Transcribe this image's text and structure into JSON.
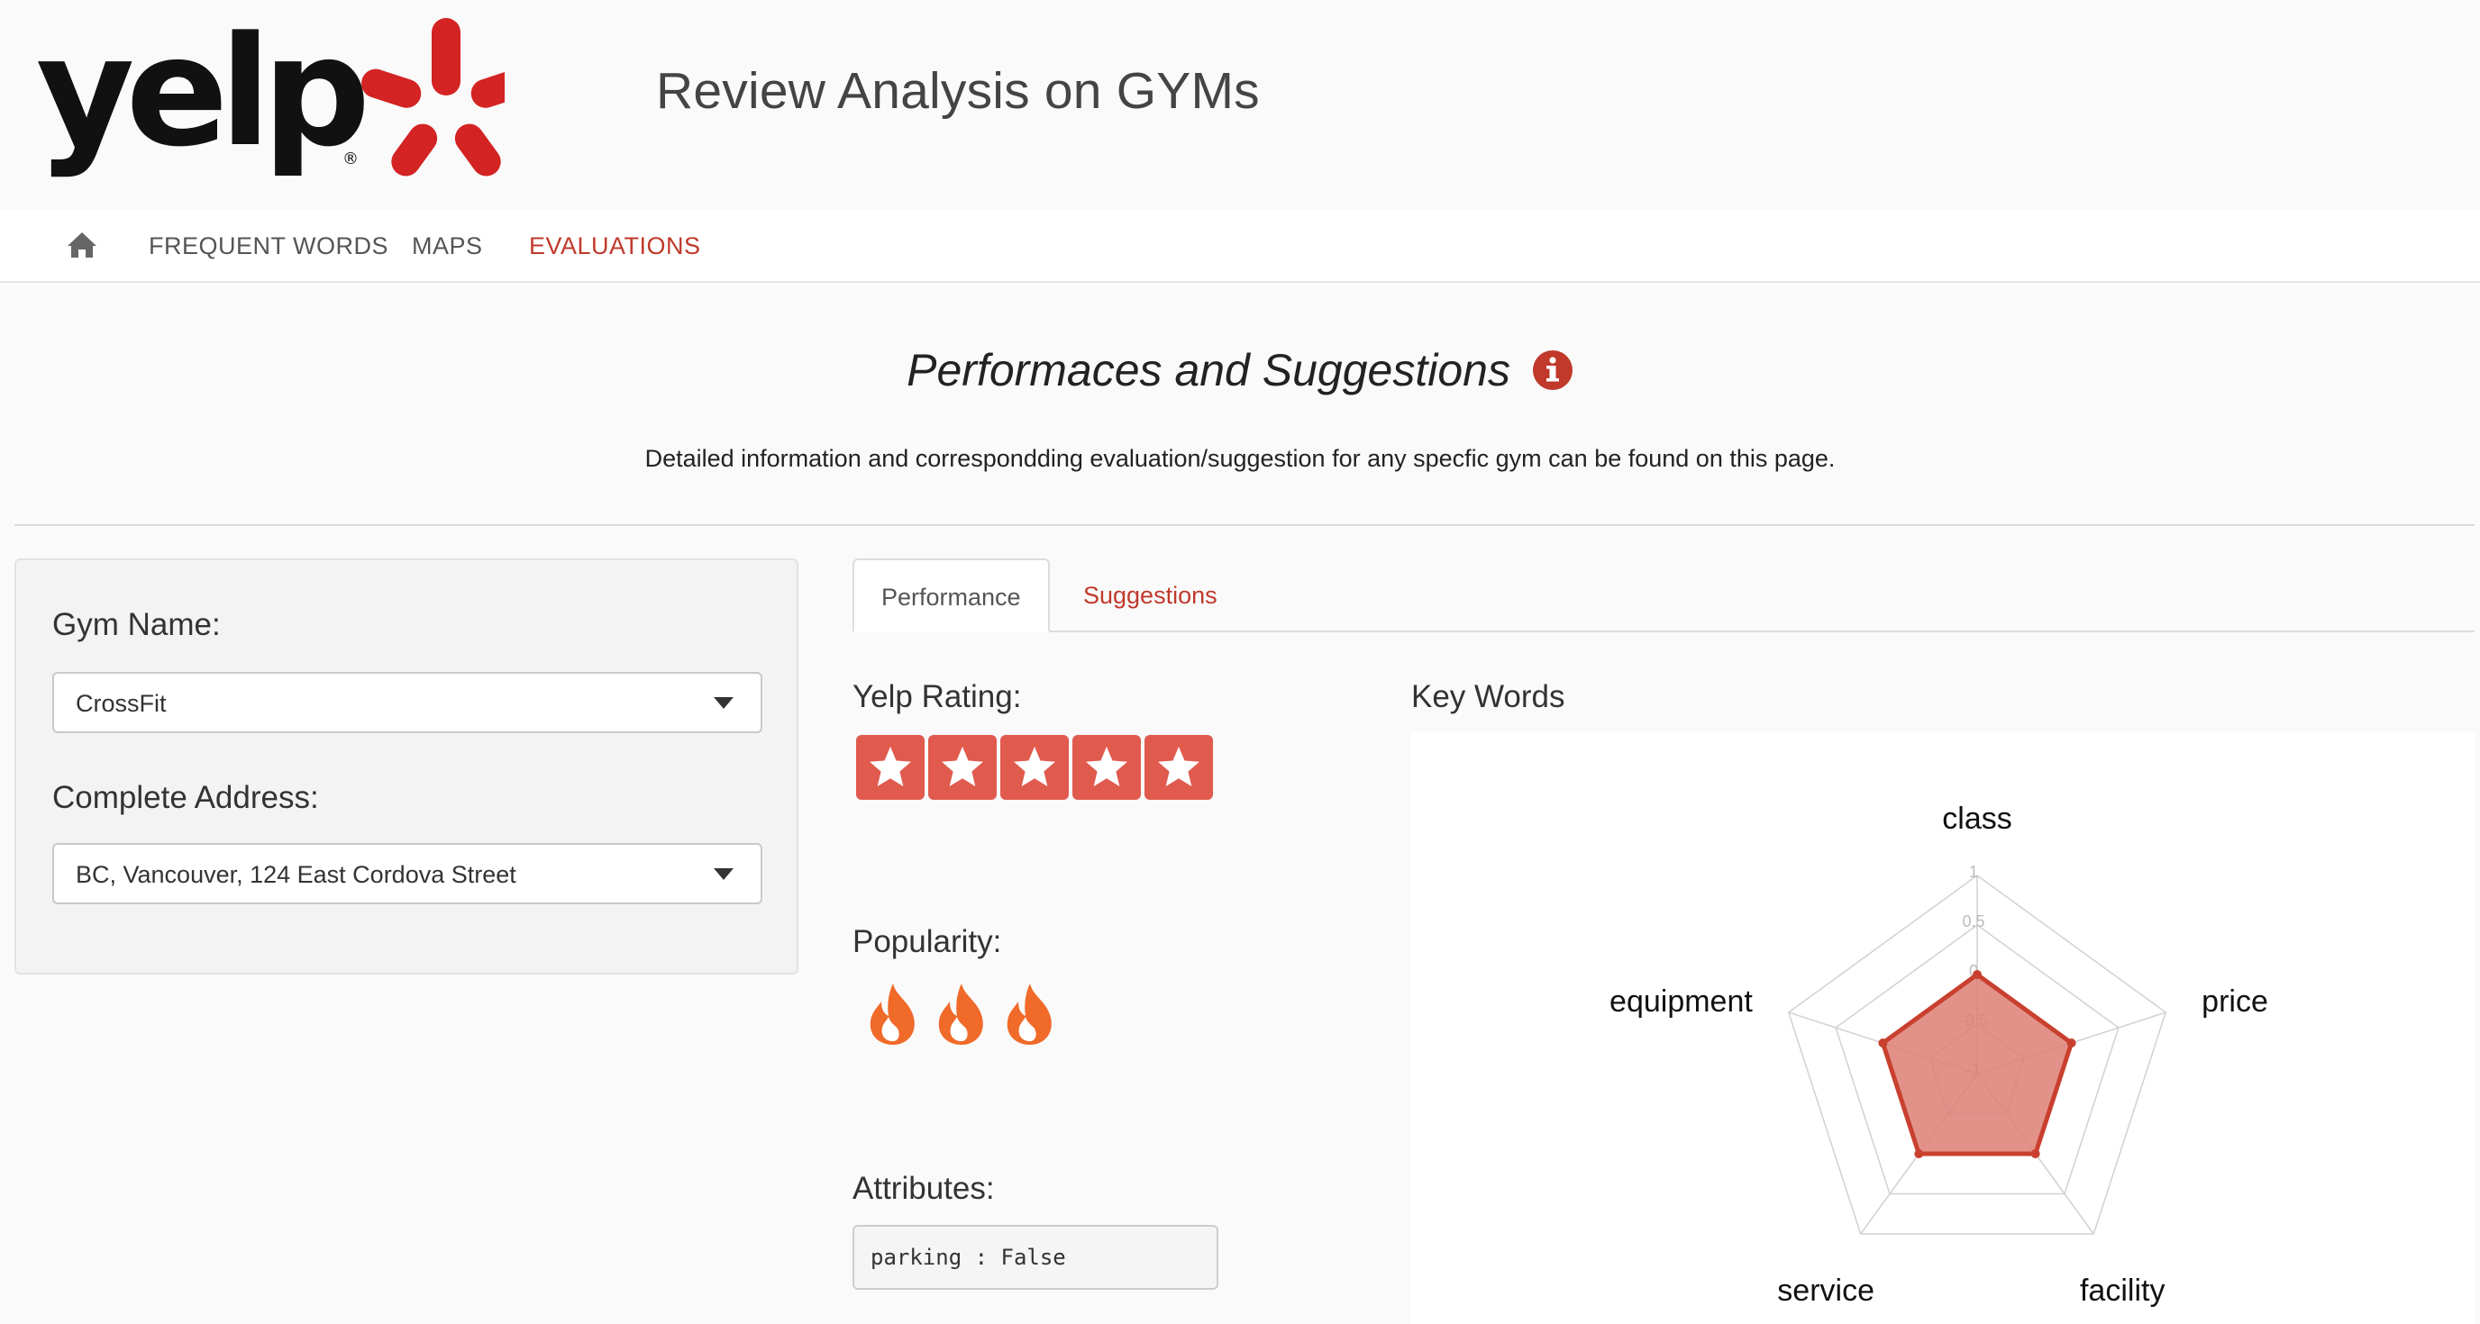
{
  "header": {
    "logo_text": "yelp",
    "title": "Review Analysis on GYMs"
  },
  "nav": {
    "home_icon": "home-icon",
    "items": [
      {
        "label": "FREQUENT WORDS",
        "active": false
      },
      {
        "label": "MAPS",
        "active": false
      },
      {
        "label": "EVALUATIONS",
        "active": true
      }
    ]
  },
  "page": {
    "title": "Performaces and Suggestions",
    "info_icon": "info-circle-icon",
    "description": "Detailed information and correspondding evaluation/suggestion for any specfic gym can be found on this page."
  },
  "sidebar": {
    "gym_name_label": "Gym Name:",
    "gym_name_value": "CrossFit",
    "address_label": "Complete Address:",
    "address_value": "BC, Vancouver, 124 East Cordova Street"
  },
  "tabs": [
    {
      "label": "Performance",
      "active": true
    },
    {
      "label": "Suggestions",
      "active": false
    }
  ],
  "performance": {
    "yelp_rating_label": "Yelp Rating:",
    "rating": 5,
    "rating_max": 5,
    "popularity_label": "Popularity:",
    "popularity": 3,
    "attributes_label": "Attributes:",
    "attributes_text": "parking : False",
    "keywords_label": "Key Words"
  },
  "colors": {
    "accent": "#c0392b",
    "star_bg": "#e05a4e",
    "flame": "#f06a2a",
    "radar_fill": "#dd7f74",
    "radar_stroke": "#c9402f"
  },
  "chart_data": {
    "type": "radar",
    "axes": [
      "class",
      "price",
      "facility",
      "service",
      "equipment"
    ],
    "range": [
      -1,
      1
    ],
    "ticks": [
      "1",
      "0.5",
      "0",
      "-0.5",
      "-1"
    ],
    "values": [
      0,
      0,
      0,
      0,
      0
    ]
  }
}
